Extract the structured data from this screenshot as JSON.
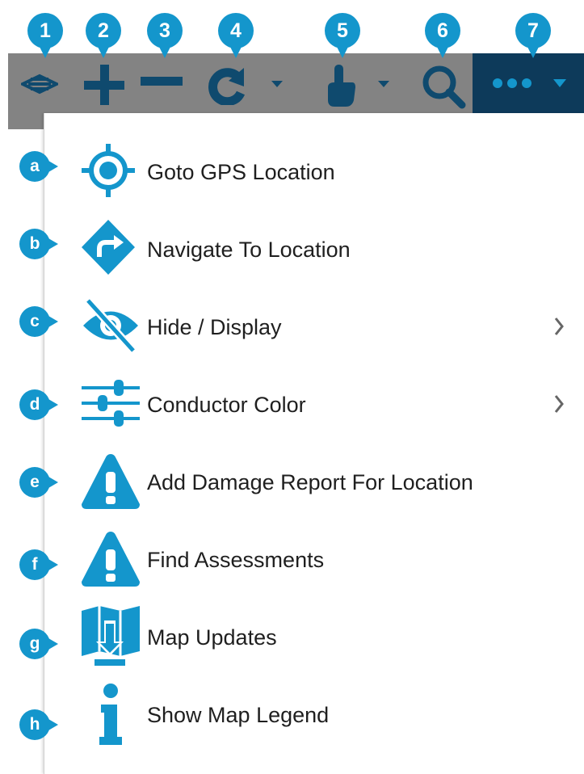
{
  "toolbar": {
    "callouts": [
      "1",
      "2",
      "3",
      "4",
      "5",
      "6",
      "7"
    ],
    "icons": [
      "layers-icon",
      "zoom-in-icon",
      "zoom-out-icon",
      "refresh-icon",
      "select-touch-icon",
      "search-icon",
      "more-icon"
    ],
    "colors": {
      "toolbar_bg": "#838383",
      "active_bg": "#0d3a5a",
      "accent": "#1496cc",
      "icon": "#0f4a6e"
    }
  },
  "menu": {
    "items": [
      {
        "badge": "a",
        "label": "Goto GPS Location",
        "icon": "gps-target-icon",
        "submenu": false
      },
      {
        "badge": "b",
        "label": "Navigate To Location",
        "icon": "navigate-arrow-icon",
        "submenu": false
      },
      {
        "badge": "c",
        "label": "Hide / Display",
        "icon": "eye-slash-icon",
        "submenu": true
      },
      {
        "badge": "d",
        "label": "Conductor Color",
        "icon": "sliders-icon",
        "submenu": true
      },
      {
        "badge": "e",
        "label": "Add Damage Report For Location",
        "icon": "warning-icon",
        "submenu": false
      },
      {
        "badge": "f",
        "label": "Find Assessments",
        "icon": "warning-icon",
        "submenu": false
      },
      {
        "badge": "g",
        "label": "Map Updates",
        "icon": "map-download-icon",
        "submenu": false
      },
      {
        "badge": "h",
        "label": "Show Map Legend",
        "icon": "info-icon",
        "submenu": false
      }
    ]
  }
}
